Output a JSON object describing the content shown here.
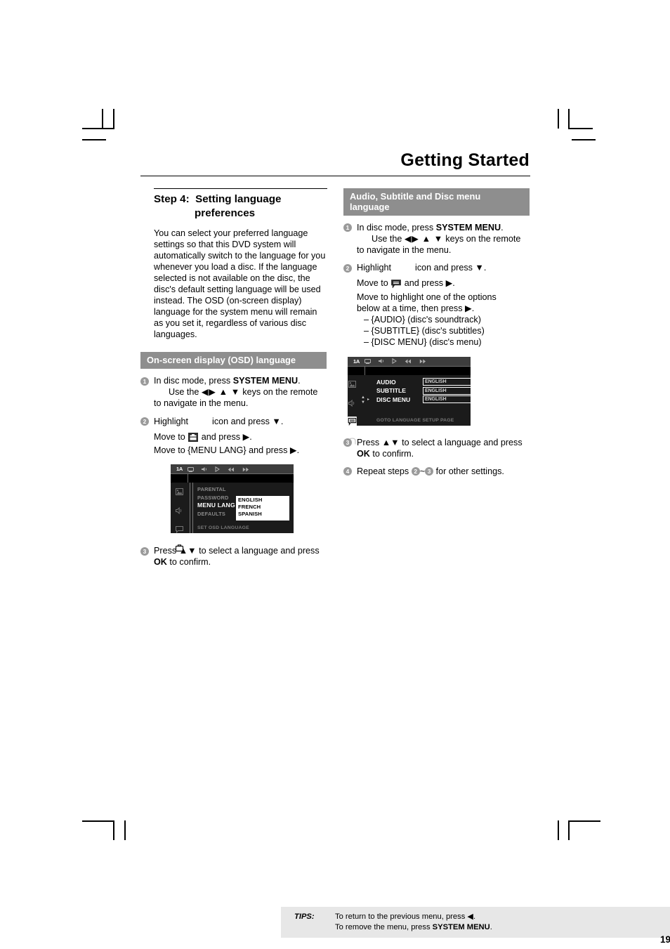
{
  "header": {
    "title": "Getting Started"
  },
  "page_number": "19",
  "left_column": {
    "step_heading": {
      "label": "Step 4:",
      "line1": "Setting language",
      "line2": "preferences"
    },
    "intro": "You can select your preferred language settings so that this DVD system will automatically switch to the language for you whenever you load a disc.  If the language selected is not available on the disc, the disc's default setting language will be used instead.  The OSD (on-screen display) language for the system menu will remain as you set it, regardless of various disc languages.",
    "section_bar": "On-screen display (OSD) language",
    "steps": [
      {
        "num": "1",
        "line1_a": "In disc mode, press ",
        "line1_b": "SYSTEM MENU",
        "line1_c": ".",
        "line2_a": "Use the ",
        "line2_arrows": "◀▶ ▲ ▼",
        "line2_b": " keys on the remote",
        "line3": "to navigate in the menu."
      },
      {
        "num": "2",
        "line1_a": "Highlight",
        "line1_b": "icon and press ▼.",
        "line2_a": "Move to ",
        "line2_b": " and press ▶.",
        "line3_a": "Move to {MENU LANG} and press ▶."
      },
      {
        "num": "3",
        "line1": "Press ▲▼ to select a language and press",
        "line2_a": "OK",
        "line2_b": " to confirm."
      }
    ],
    "osd": {
      "title": "1A",
      "topbar_icons": [
        "tv-icon",
        "audio-icon",
        "play-icon",
        "prev-icon",
        "next-icon"
      ],
      "sidebar_icons": [
        "picture-icon",
        "audio-icon",
        "subtitle-icon",
        "preferences-icon"
      ],
      "rows": [
        "PARENTAL",
        "PASSWORD",
        "MENU LANG",
        "DEFAULTS"
      ],
      "highlighted_row": "MENU LANG",
      "popup_options": [
        "ENGLISH",
        "FRENCH",
        "SPANISH"
      ],
      "footer": "SET OSD LANGUAGE"
    }
  },
  "right_column": {
    "section_bar_line1": "Audio, Subtitle and Disc menu",
    "section_bar_line2": "language",
    "steps": [
      {
        "num": "1",
        "line1_a": "In disc mode, press ",
        "line1_b": "SYSTEM MENU",
        "line1_c": ".",
        "line2_a": "Use the ",
        "line2_arrows": "◀▶ ▲ ▼",
        "line2_b": " keys on the remote",
        "line3": "to navigate in the menu."
      },
      {
        "num": "2",
        "line1_a": "Highlight",
        "line1_b": "icon and press ▼.",
        "line2_a": "Move to ",
        "line2_b": " and press ▶.",
        "line3": "Move to highlight one of the options",
        "line4": "below at a time, then press ▶.",
        "bullets": [
          "–  {AUDIO} (disc's soundtrack)",
          "–  {SUBTITLE} (disc's subtitles)",
          "–  {DISC MENU} (disc's menu)"
        ]
      },
      {
        "num": "3",
        "line1": "Press ▲▼ to select a language and press",
        "line2_a": "OK",
        "line2_b": " to confirm."
      },
      {
        "num": "4",
        "text_a": "Repeat steps ",
        "ref1": "2",
        "text_b": "~",
        "ref2": "3",
        "text_c": " for other settings."
      }
    ],
    "osd": {
      "title": "1A",
      "topbar_icons": [
        "tv-icon",
        "audio-icon",
        "play-icon",
        "prev-icon",
        "next-icon"
      ],
      "sidebar_icons": [
        "picture-icon",
        "audio-icon",
        "subtitle-icon",
        "preferences-icon"
      ],
      "settings": [
        {
          "label": "AUDIO",
          "value": "ENGLISH"
        },
        {
          "label": "SUBTITLE",
          "value": "ENGLISH"
        },
        {
          "label": "DISC MENU",
          "value": "ENGLISH"
        }
      ],
      "footer": "GOTO LANGUAGE SETUP PAGE"
    }
  },
  "tips": {
    "label": "TIPS:",
    "line1": "To return to the previous menu, press ◀.",
    "line2_a": "To remove the menu, press ",
    "line2_b": "SYSTEM MENU",
    "line2_c": "."
  },
  "colors": {
    "section_bar_bg": "#8e8e8e",
    "tips_bg": "#e7e7e7",
    "step_num_bg": "#9a9a9a"
  }
}
